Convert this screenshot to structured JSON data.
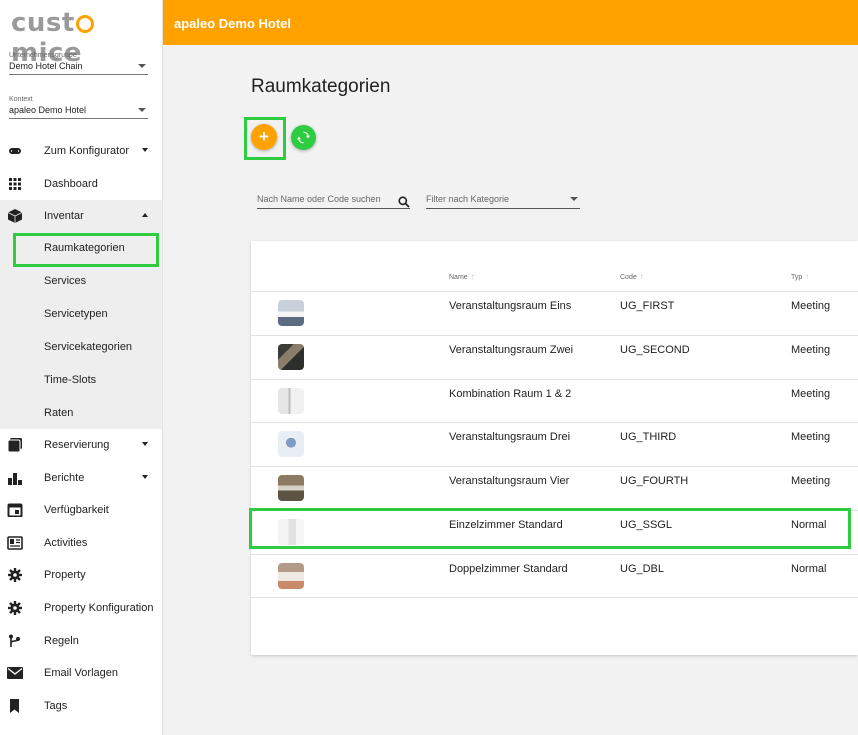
{
  "app": {
    "logo": "cust mice",
    "header_title": "apaleo Demo Hotel"
  },
  "sidebar": {
    "group_label": "Unternehmensgruppe",
    "group_value": "Demo Hotel Chain",
    "context_label": "Kontext",
    "context_value": "apaleo Demo Hotel",
    "items": [
      {
        "label": "Zum Konfigurator",
        "icon": "link-icon"
      },
      {
        "label": "Dashboard",
        "icon": "grid-icon"
      },
      {
        "label": "Inventar",
        "icon": "cube-icon"
      },
      {
        "label": "Raumkategorien"
      },
      {
        "label": "Services"
      },
      {
        "label": "Servicetypen"
      },
      {
        "label": "Servicekategorien"
      },
      {
        "label": "Time-Slots"
      },
      {
        "label": "Raten"
      },
      {
        "label": "Reservierung",
        "icon": "layers-icon"
      },
      {
        "label": "Berichte",
        "icon": "bar-chart-icon"
      },
      {
        "label": "Verfügbarkeit",
        "icon": "calendar-icon"
      },
      {
        "label": "Activities",
        "icon": "newspaper-icon"
      },
      {
        "label": "Property",
        "icon": "gear-icon"
      },
      {
        "label": "Property Konfiguration",
        "icon": "gear-icon"
      },
      {
        "label": "Regeln",
        "icon": "route-icon"
      },
      {
        "label": "Email Vorlagen",
        "icon": "mail-icon"
      },
      {
        "label": "Tags",
        "icon": "bookmark-icon"
      }
    ]
  },
  "main": {
    "title": "Raumkategorien",
    "add_icon": "+",
    "search_placeholder": "Nach Name oder Code suchen",
    "filter_placeholder": "Filter nach Kategorie",
    "columns": {
      "name": "Name",
      "code": "Code",
      "type": "Typ"
    },
    "rows": [
      {
        "name": "Veranstaltungsraum Eins",
        "code": "UG_FIRST",
        "type": "Meeting"
      },
      {
        "name": "Veranstaltungsraum Zwei",
        "code": "UG_SECOND",
        "type": "Meeting"
      },
      {
        "name": "Kombination Raum 1 & 2",
        "code": "",
        "type": "Meeting"
      },
      {
        "name": "Veranstaltungsraum Drei",
        "code": "UG_THIRD",
        "type": "Meeting"
      },
      {
        "name": "Veranstaltungsraum Vier",
        "code": "UG_FOURTH",
        "type": "Meeting"
      },
      {
        "name": "Einzelzimmer Standard",
        "code": "UG_SSGL",
        "type": "Normal"
      },
      {
        "name": "Doppelzimmer Standard",
        "code": "UG_DBL",
        "type": "Normal"
      }
    ]
  },
  "colors": {
    "accent": "#ffa200",
    "green": "#2ecc40",
    "highlight": "#2ecc40"
  }
}
